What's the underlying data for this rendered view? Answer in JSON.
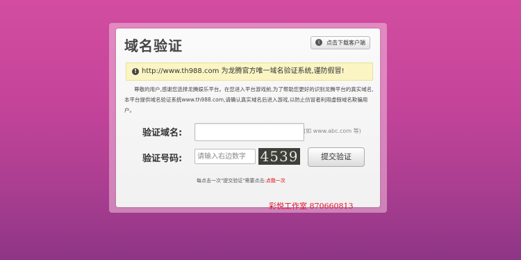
{
  "dialog": {
    "title": "域名验证",
    "download_button_label": "点击下载客户端",
    "download_icon": "info-icon",
    "notice_icon": "warning-icon",
    "notice": "http://www.th988.com 为龙腾官方唯一域名验证系统,谨防假冒!",
    "description": "尊敬的用户,感谢您选择龙腾娱乐平台。在您进入平台游戏前,为了帮助您更好的识别龙腾平台的真实域名,本平台提供域名验证系统www.th988.com,请确认真实域名后进入游戏,以防止仿冒者利用虚假域名欺骗用户。"
  },
  "form": {
    "domain_label": "验证域名:",
    "domain_value": "",
    "domain_hint": "(如 www.abc.com 等)",
    "code_label": "验证号码:",
    "code_placeholder": "请输入右边数字",
    "captcha_text": "4539",
    "submit_label": "提交验证",
    "tip_prefix": "每点击一次\"提交验证\"需要点击:",
    "tip_link": "点我一次"
  },
  "footer_credit": "彩悦工作室 870660813"
}
